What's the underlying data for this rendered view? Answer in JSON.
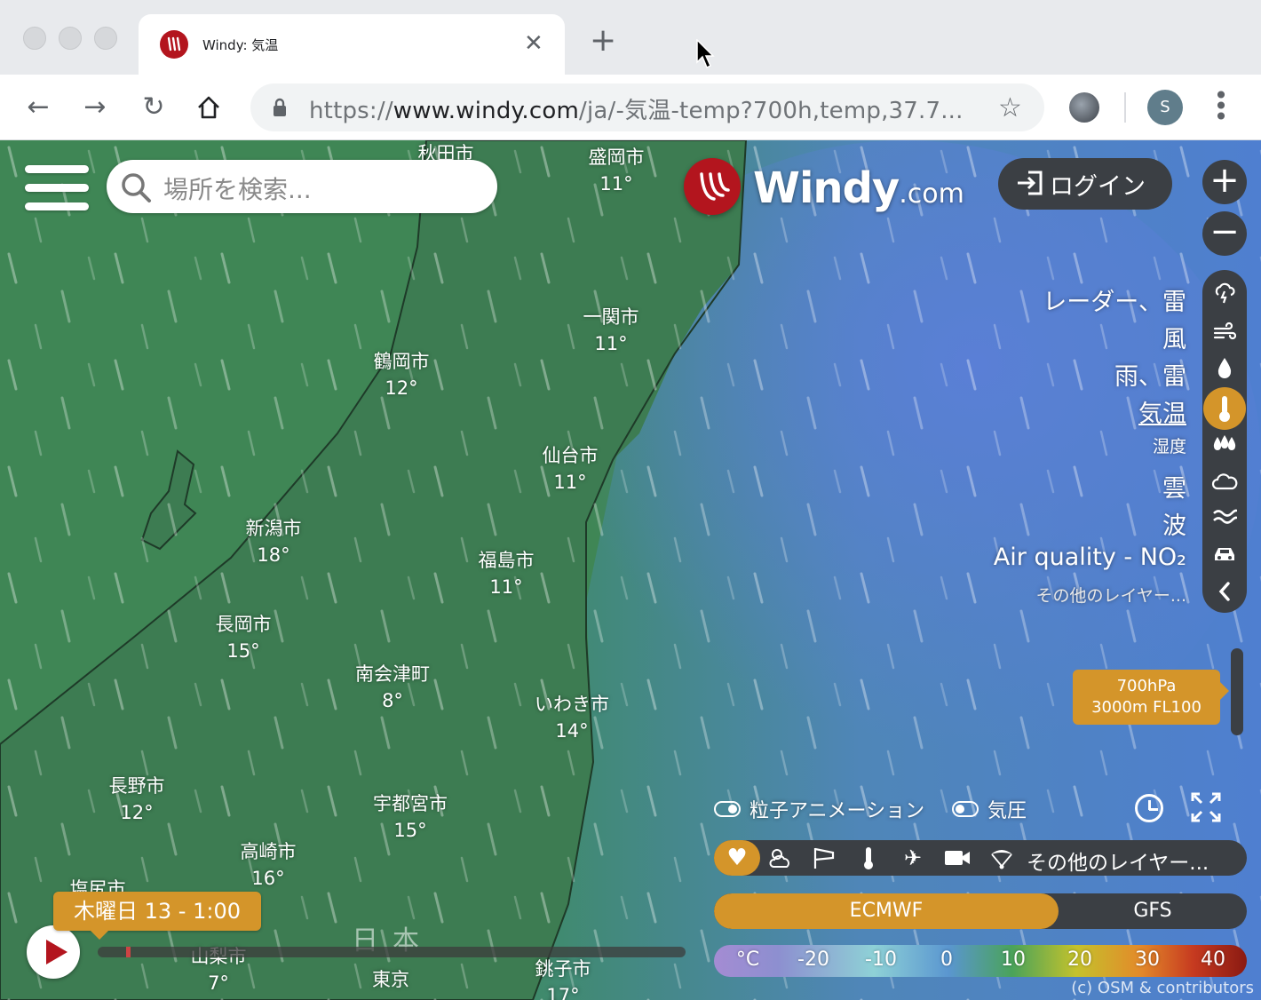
{
  "browser": {
    "tab_title": "Windy: 気温",
    "url_prefix": "https://",
    "url_host": "www.windy.com",
    "url_path": "/ja/-気温-temp?700h,temp,37.7...",
    "profile_initial": "S"
  },
  "header": {
    "search_placeholder": "場所を検索...",
    "logo_main": "Windy",
    "logo_suffix": ".com",
    "login_label": "ログイン",
    "zoom_in": "+",
    "zoom_out": "−"
  },
  "cities": [
    {
      "name": "秋田市",
      "temp": ""
    },
    {
      "name": "盛岡市",
      "temp": "11°"
    },
    {
      "name": "一関市",
      "temp": "11°"
    },
    {
      "name": "鶴岡市",
      "temp": "12°"
    },
    {
      "name": "仙台市",
      "temp": "11°"
    },
    {
      "name": "新潟市",
      "temp": "18°"
    },
    {
      "name": "福島市",
      "temp": "11°"
    },
    {
      "name": "長岡市",
      "temp": "15°"
    },
    {
      "name": "南会津町",
      "temp": "8°"
    },
    {
      "name": "いわき市",
      "temp": "14°"
    },
    {
      "name": "長野市",
      "temp": "12°"
    },
    {
      "name": "宇都宮市",
      "temp": "15°"
    },
    {
      "name": "高崎市",
      "temp": "16°"
    },
    {
      "name": "塩尻市",
      "temp": ""
    },
    {
      "name": "山梨市",
      "temp": "7°"
    },
    {
      "name": "東京",
      "temp": ""
    },
    {
      "name": "銚子市",
      "temp": "17°"
    }
  ],
  "region_label": "日本",
  "layers": [
    {
      "label": "レーダー、雷",
      "icon": "lightning-cloud-icon"
    },
    {
      "label": "風",
      "icon": "wind-icon"
    },
    {
      "label": "雨、雷",
      "icon": "raindrop-icon"
    },
    {
      "label": "気温",
      "icon": "thermometer-icon",
      "active": true
    },
    {
      "label": "湿度",
      "icon": "humidity-icon"
    },
    {
      "label": "雲",
      "icon": "cloud-icon"
    },
    {
      "label": "波",
      "icon": "waves-icon"
    },
    {
      "label": "Air quality - NO₂",
      "icon": "car-icon"
    }
  ],
  "layers_more": "その他のレイヤー...",
  "altitude": {
    "line1": "700hPa",
    "line2": "3000m FL100"
  },
  "toggles": {
    "particles": "粒子アニメーション",
    "pressure": "気圧"
  },
  "overlay_more": "その他のレイヤー...",
  "models": {
    "primary": "ECMWF",
    "secondary": "GFS"
  },
  "legend": [
    "°C",
    "-20",
    "-10",
    "0",
    "10",
    "20",
    "30",
    "40"
  ],
  "timeline": {
    "current": "木曜日 13 - 1:00"
  },
  "copyright": "(c) OSM & contributors",
  "colors": {
    "accent": "#d4952a",
    "brand": "#b3151e",
    "panel": "#3b3f44"
  }
}
